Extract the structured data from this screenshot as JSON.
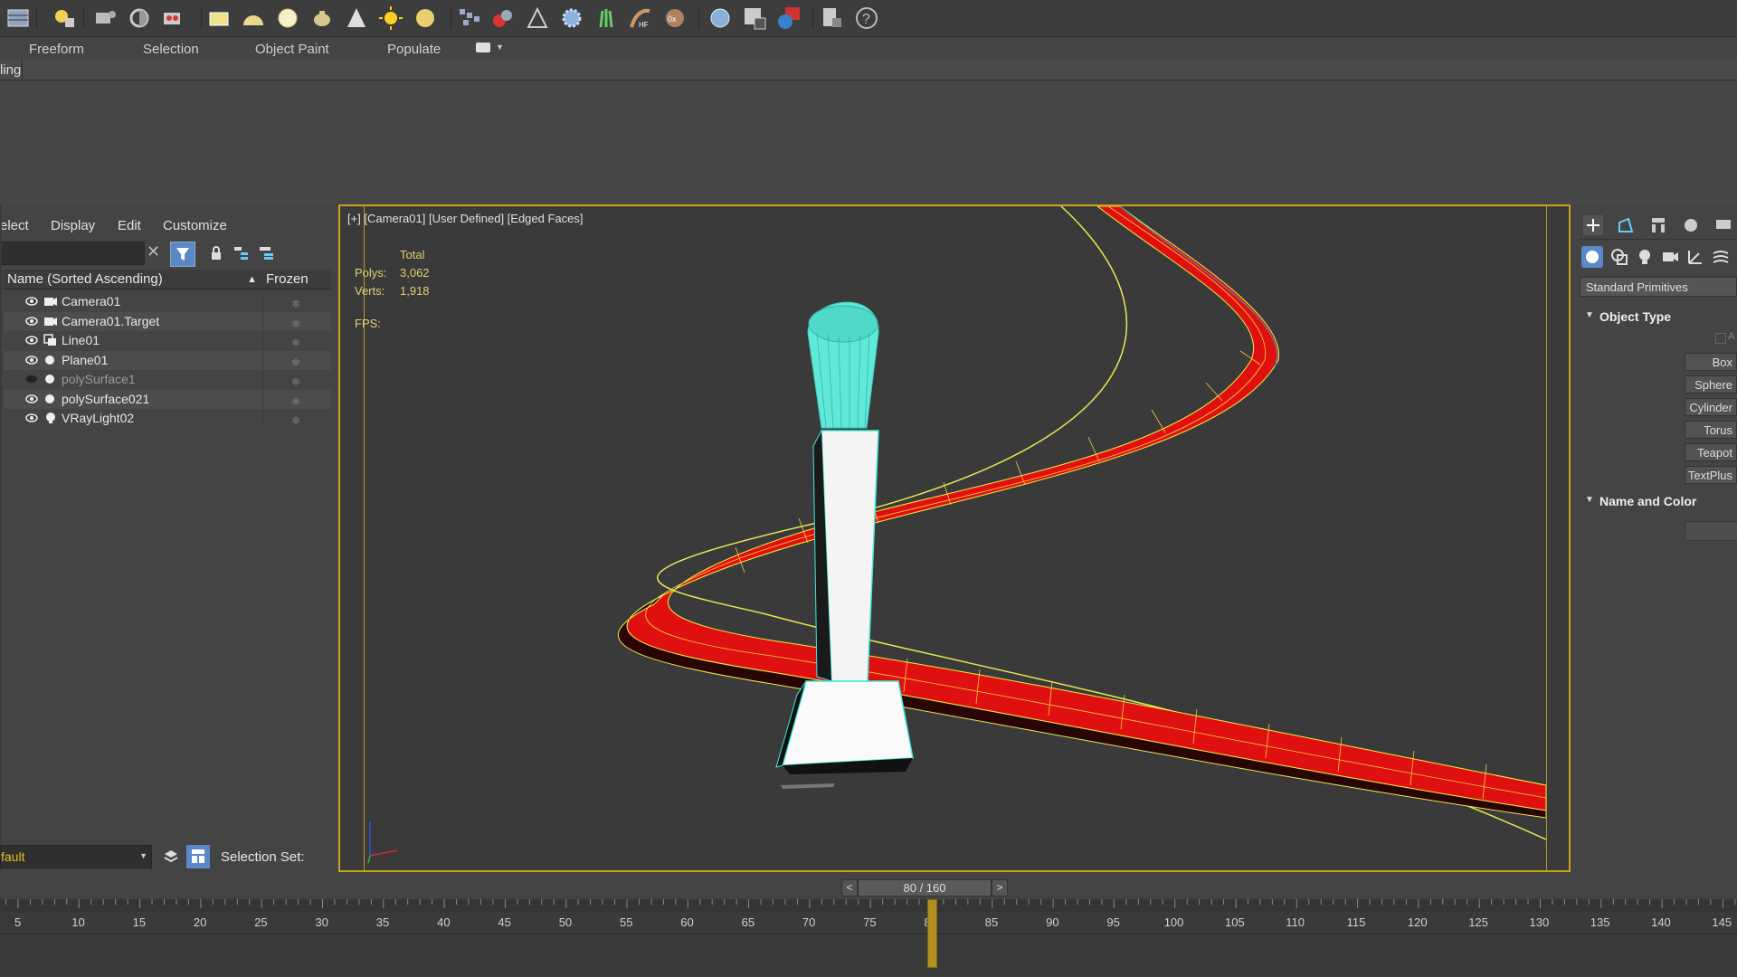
{
  "ribbon": {
    "tabs": [
      "Freeform",
      "Selection",
      "Object Paint",
      "Populate"
    ],
    "sub_label": "ling"
  },
  "explorer": {
    "menu": [
      "elect",
      "Display",
      "Edit",
      "Customize"
    ],
    "columns": {
      "name": "Name (Sorted Ascending)",
      "frozen": "Frozen"
    },
    "rows": [
      {
        "name": "Camera01",
        "type": "camera-icon",
        "hidden": false
      },
      {
        "name": "Camera01.Target",
        "type": "camera-icon",
        "hidden": false
      },
      {
        "name": "Line01",
        "type": "shape-icon",
        "hidden": false
      },
      {
        "name": "Plane01",
        "type": "geometry-icon",
        "hidden": false
      },
      {
        "name": "polySurface1",
        "type": "geometry-icon",
        "hidden": true
      },
      {
        "name": "polySurface021",
        "type": "geometry-icon",
        "hidden": false
      },
      {
        "name": "VRayLight02",
        "type": "light-icon",
        "hidden": false
      }
    ],
    "layer_value": "fault",
    "selection_set_label": "Selection Set:"
  },
  "viewport": {
    "label": "[+] [Camera01] [User Defined] [Edged Faces]",
    "stats": {
      "total_label": "Total",
      "polys_label": "Polys:",
      "polys_value": "3,062",
      "verts_label": "Verts:",
      "verts_value": "1,918",
      "fps_label": "FPS:"
    }
  },
  "command_panel": {
    "dropdown": "Standard Primitives",
    "object_type_title": "Object Type",
    "autogrid": "A",
    "buttons": [
      "Box",
      "Sphere",
      "Cylinder",
      "Torus",
      "Teapot",
      "TextPlus"
    ],
    "name_color_title": "Name and Color"
  },
  "time": {
    "slider_label": "80 / 160",
    "prev": "<",
    "next": ">",
    "current_frame": 80,
    "ticks": [
      "5",
      "10",
      "15",
      "20",
      "25",
      "30",
      "35",
      "40",
      "45",
      "50",
      "55",
      "60",
      "65",
      "70",
      "75",
      "80",
      "85",
      "90",
      "95",
      "100",
      "105",
      "110",
      "115",
      "120",
      "125",
      "130",
      "135",
      "140",
      "145"
    ]
  },
  "colors": {
    "viewport_border": "#c9a318",
    "spline_red": "#e01010",
    "wireframe_yellow": "#e8e850",
    "selection_cyan": "#40e8d8"
  }
}
